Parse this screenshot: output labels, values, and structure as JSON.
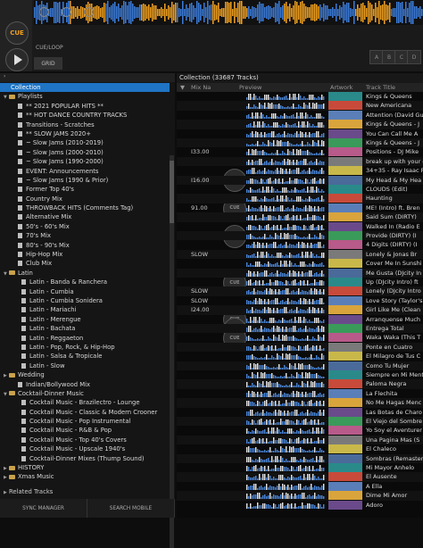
{
  "deck": {
    "cue_label": "CUE",
    "cueloop_label": "CUE/LOOP",
    "grid_label": "GRID",
    "pads": [
      "A",
      "B",
      "C",
      "D"
    ]
  },
  "sidebar": {
    "items": [
      {
        "label": "Collection",
        "kind": "collection",
        "selected": true
      },
      {
        "label": "Playlists",
        "kind": "folder-open"
      },
      {
        "label": "** 2021 POPULAR HITS **",
        "kind": "list"
      },
      {
        "label": "** HOT DANCE COUNTRY TRACKS",
        "kind": "list"
      },
      {
        "label": "Transitions - Scratches",
        "kind": "list"
      },
      {
        "label": "** SLOW JAMS 2020+",
        "kind": "list"
      },
      {
        "label": "~ Slow Jams (2010-2019)",
        "kind": "list"
      },
      {
        "label": "~ Slow Jams (2000-2010)",
        "kind": "list"
      },
      {
        "label": "~ Slow Jams (1990-2000)",
        "kind": "list"
      },
      {
        "label": "EVENT:  Announcements",
        "kind": "list"
      },
      {
        "label": "~ Slow Jams (1990 & Prior)",
        "kind": "list"
      },
      {
        "label": "Former Top 40's",
        "kind": "list"
      },
      {
        "label": "Country Mix",
        "kind": "list"
      },
      {
        "label": "THROWBACK HITS  (Comments Tag)",
        "kind": "list"
      },
      {
        "label": "Alternative Mix",
        "kind": "list"
      },
      {
        "label": "50's - 60's Mix",
        "kind": "list"
      },
      {
        "label": "70's Mix",
        "kind": "list"
      },
      {
        "label": "80's - 90's  Mix",
        "kind": "list"
      },
      {
        "label": "Hip-Hop Mix",
        "kind": "list"
      },
      {
        "label": "Club Mix",
        "kind": "list"
      },
      {
        "label": "Latin",
        "kind": "folder-open"
      },
      {
        "label": "Latin - Banda & Ranchera",
        "kind": "sub"
      },
      {
        "label": "Latin - Cumbia",
        "kind": "sub"
      },
      {
        "label": "Latin - Cumbia Sonidera",
        "kind": "sub"
      },
      {
        "label": "Latin - Mariachi",
        "kind": "sub"
      },
      {
        "label": "Latin - Merengue",
        "kind": "sub"
      },
      {
        "label": "Latin - Bachata",
        "kind": "sub"
      },
      {
        "label": "Latin - Reggaeton",
        "kind": "sub"
      },
      {
        "label": "Latin - Pop, Rock, & Hip-Hop",
        "kind": "sub"
      },
      {
        "label": "Latin - Salsa & Tropicale",
        "kind": "sub"
      },
      {
        "label": "Latin - Slow",
        "kind": "sub"
      },
      {
        "label": "Wedding",
        "kind": "folder"
      },
      {
        "label": "Indian/Bollywood Mix",
        "kind": "list"
      },
      {
        "label": "Cocktail-Dinner Music",
        "kind": "folder-open"
      },
      {
        "label": "Cocktail Music - Brazilectro - Lounge",
        "kind": "sub"
      },
      {
        "label": "Cocktail Music - Classic & Modern Crooner",
        "kind": "sub"
      },
      {
        "label": "Cocktail Music - Pop Instrumental",
        "kind": "sub"
      },
      {
        "label": "Cocktail Music - R&B & Pop",
        "kind": "sub"
      },
      {
        "label": "Cocktail Music - Top 40's Covers",
        "kind": "sub"
      },
      {
        "label": "Cocktail Music - Upscale 1940's",
        "kind": "sub"
      },
      {
        "label": "Cocktail-Dinner Mixes (Thump Sound)",
        "kind": "sub"
      },
      {
        "label": "HISTORY",
        "kind": "folder"
      },
      {
        "label": "Xmas Music",
        "kind": "folder"
      }
    ],
    "related_tracks": "Related Tracks",
    "sync_manager": "SYNC MANAGER",
    "search_mobile": "SEARCH MOBILE"
  },
  "collection": {
    "header": "Collection (33687 Tracks)",
    "columns": {
      "mix": "Mix Na",
      "preview": "Preview",
      "artwork": "Artwork",
      "title": "Track Title"
    },
    "rows": [
      {
        "mix": "",
        "title": "Kings & Queens"
      },
      {
        "mix": "",
        "title": "New Americana"
      },
      {
        "mix": "",
        "title": "Attention (David Gu"
      },
      {
        "mix": "",
        "title": "Kings & Queens - J"
      },
      {
        "mix": "",
        "title": "You Can Call Me A"
      },
      {
        "mix": "",
        "title": "Kings & Queens - J"
      },
      {
        "mix": "I33.00",
        "title": "Positions - DJ Mike"
      },
      {
        "mix": "",
        "title": "break up with your g"
      },
      {
        "mix": "",
        "title": "34+35 - Ray Isaac R"
      },
      {
        "mix": "I16.00",
        "title": "My Head & My Hea"
      },
      {
        "mix": "",
        "title": "CLOUDS (Edit)"
      },
      {
        "mix": "",
        "title": "Haunting"
      },
      {
        "mix": "91.00",
        "title": "ME! (Intro)  ft. Bren"
      },
      {
        "mix": "",
        "title": "Said Sum  (DIRTY)"
      },
      {
        "mix": "",
        "title": "Walked In  (Radio E"
      },
      {
        "mix": "",
        "title": "Provide  (DIRTY) (I"
      },
      {
        "mix": "",
        "title": "4 Digits  (DIRTY) (I"
      },
      {
        "mix": "SLOW",
        "title": "Lonely  & Jonas Br"
      },
      {
        "mix": "",
        "title": "Cover Me In Sunshi"
      },
      {
        "mix": "",
        "title": "Me Gusta (DJcity In"
      },
      {
        "mix": "",
        "title": "Up (DJcity Intro) ft"
      },
      {
        "mix": "SLOW",
        "title": "Lonely (DJcity Intro"
      },
      {
        "mix": "SLOW",
        "title": "Love Story (Taylor's"
      },
      {
        "mix": "I24.00",
        "title": "Girl Like Me  (Clean"
      },
      {
        "mix": "",
        "title": "Arranquense Much"
      },
      {
        "mix": "",
        "title": "Entrega Total"
      },
      {
        "mix": "",
        "title": "Waka Waka (This T"
      },
      {
        "mix": "",
        "title": "Ponte en Cuatro"
      },
      {
        "mix": "",
        "title": "El Milagro de Tus C"
      },
      {
        "mix": "",
        "title": "Como Tu Mujer"
      },
      {
        "mix": "",
        "title": "Siempre en Mi Ment"
      },
      {
        "mix": "",
        "title": "Paloma Negra"
      },
      {
        "mix": "",
        "title": "La Flechita"
      },
      {
        "mix": "",
        "title": "No Me Hagas Menc"
      },
      {
        "mix": "",
        "title": "Las Botas de Charo"
      },
      {
        "mix": "",
        "title": "El Viejo del Sombre"
      },
      {
        "mix": "",
        "title": "Yo Soy el Aventurer"
      },
      {
        "mix": "",
        "title": "Una Pagina Mas  (S"
      },
      {
        "mix": "",
        "title": "El Chaleco"
      },
      {
        "mix": "",
        "title": "Sombras (Remaster"
      },
      {
        "mix": "",
        "title": "Mi Mayor Anhelo"
      },
      {
        "mix": "",
        "title": "El Ausente"
      },
      {
        "mix": "",
        "title": "A Ella"
      },
      {
        "mix": "",
        "title": "Dime Mi Amor"
      },
      {
        "mix": "",
        "title": "Adoro"
      }
    ]
  },
  "colors": {
    "accent": "#1f74c4",
    "wave_orange": "#f0a020",
    "wave_blue": "#3b7bd8"
  }
}
